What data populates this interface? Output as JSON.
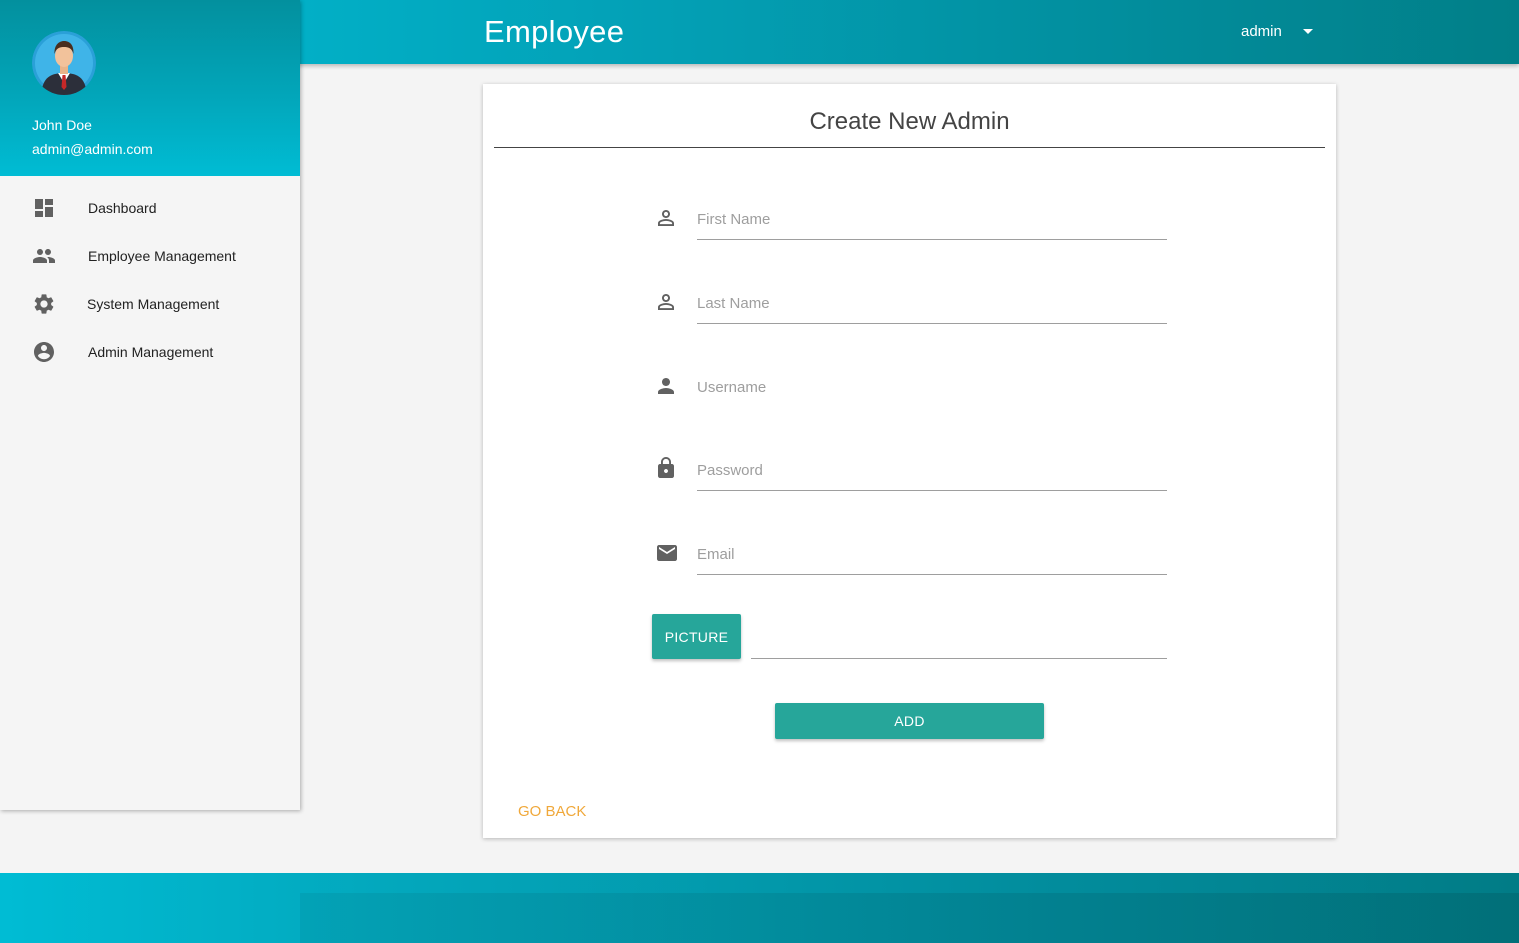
{
  "header": {
    "app_title": "Employee",
    "user_menu_label": "admin"
  },
  "sidebar": {
    "user_name": "John Doe",
    "user_email": "admin@admin.com",
    "items": [
      {
        "label": "Dashboard",
        "icon": "dashboard-icon"
      },
      {
        "label": "Employee Management",
        "icon": "people-icon"
      },
      {
        "label": "System Management",
        "icon": "gear-icon"
      },
      {
        "label": "Admin Management",
        "icon": "account-circle-icon"
      }
    ]
  },
  "form": {
    "title": "Create New Admin",
    "fields": [
      {
        "placeholder": "First Name",
        "value": "",
        "icon": "person-outline-icon"
      },
      {
        "placeholder": "Last Name",
        "value": "",
        "icon": "person-outline-icon"
      },
      {
        "placeholder": "Username",
        "value": "",
        "icon": "person-icon"
      },
      {
        "placeholder": "Password",
        "value": "",
        "icon": "lock-icon"
      },
      {
        "placeholder": "Email",
        "value": "",
        "icon": "email-icon"
      }
    ],
    "picture_label": "PICTURE",
    "picture_path": "",
    "add_label": "ADD",
    "go_back_label": "GO BACK"
  },
  "colors": {
    "primary": "#00bcd4",
    "primary_dark": "#017f88",
    "button": "#26a69a",
    "link": "#f0a83a",
    "icon": "#616161"
  }
}
